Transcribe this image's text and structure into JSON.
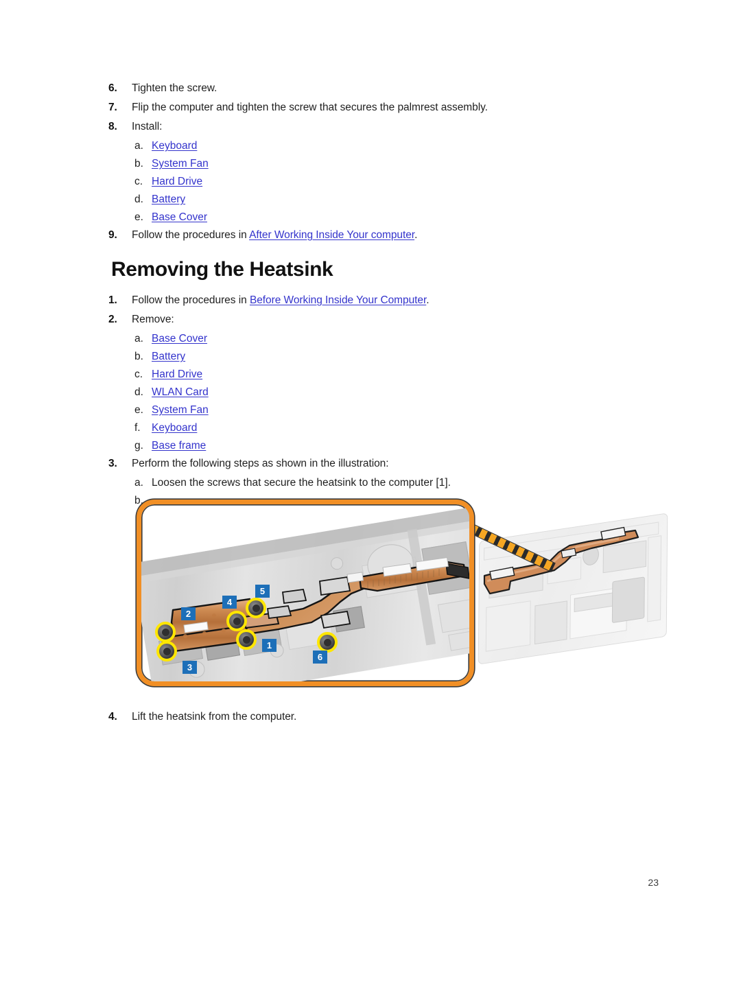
{
  "document": {
    "page_number": "23"
  },
  "previous_procedure": {
    "steps": [
      {
        "marker": "6.",
        "text": "Tighten the screw."
      },
      {
        "marker": "7.",
        "text": "Flip the computer and tighten the screw that secures the palmrest assembly."
      },
      {
        "marker": "8.",
        "text": "Install:"
      }
    ],
    "install_items": [
      {
        "marker": "a.",
        "label": "Keyboard"
      },
      {
        "marker": "b.",
        "label": "System Fan"
      },
      {
        "marker": "c.",
        "label": "Hard Drive"
      },
      {
        "marker": "d.",
        "label": "Battery"
      },
      {
        "marker": "e.",
        "label": "Base Cover"
      }
    ],
    "final_step": {
      "marker": "9.",
      "prefix": "Follow the procedures in ",
      "link": "After Working Inside Your computer",
      "suffix": "."
    }
  },
  "section": {
    "title": "Removing the Heatsink",
    "step1": {
      "marker": "1.",
      "prefix": "Follow the procedures in ",
      "link": "Before Working Inside Your Computer",
      "suffix": "."
    },
    "step2": {
      "marker": "2.",
      "text": "Remove:"
    },
    "remove_items": [
      {
        "marker": "a.",
        "label": "Base Cover"
      },
      {
        "marker": "b.",
        "label": "Battery"
      },
      {
        "marker": "c.",
        "label": "Hard Drive"
      },
      {
        "marker": "d.",
        "label": "WLAN Card"
      },
      {
        "marker": "e.",
        "label": "System Fan"
      },
      {
        "marker": "f.",
        "label": "Keyboard"
      },
      {
        "marker": "g.",
        "label": "Base frame"
      }
    ],
    "step3": {
      "marker": "3.",
      "text": "Perform the following steps as shown in the illustration:"
    },
    "step3_items": [
      {
        "marker": "a.",
        "text": "Loosen the screws that secure the heatsink to the computer [1]."
      },
      {
        "marker": "b.",
        "text": ""
      }
    ],
    "step4": {
      "marker": "4.",
      "text": "Lift the heatsink from the computer."
    }
  },
  "figure": {
    "callouts": [
      {
        "number": "1"
      },
      {
        "number": "2"
      },
      {
        "number": "3"
      },
      {
        "number": "4"
      },
      {
        "number": "5"
      },
      {
        "number": "6"
      }
    ],
    "colors": {
      "zoom_border": "#f18f25",
      "callout_ring": "#ffe600",
      "badge": "#1d6fb8",
      "copper": "#c87b3f",
      "link": "#3333cc"
    }
  }
}
